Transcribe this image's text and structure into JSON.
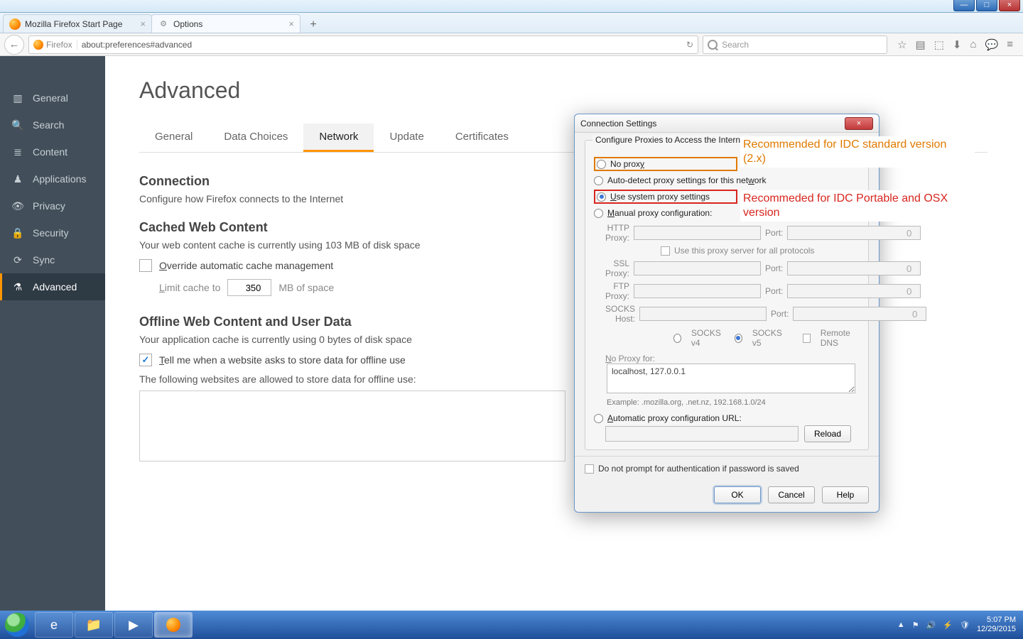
{
  "window": {
    "min": "—",
    "max": "□",
    "close": "×"
  },
  "tabs": {
    "tab1": "Mozilla Firefox Start Page",
    "tab2": "Options",
    "newtab": "+"
  },
  "nav": {
    "back": "←",
    "identity_label": "Firefox",
    "url": "about:preferences#advanced",
    "reload": "↻",
    "search_placeholder": "Search"
  },
  "toolbar_icons": {
    "bookmark": "☆",
    "clipboard": "▤",
    "pocket": "⬚",
    "download": "⬇",
    "home": "⌂",
    "chat": "💬",
    "menu": "≡"
  },
  "sidebar": {
    "items": [
      {
        "icon": "▥",
        "label": "General"
      },
      {
        "icon": "🔍",
        "label": "Search"
      },
      {
        "icon": "≣",
        "label": "Content"
      },
      {
        "icon": "♟",
        "label": "Applications"
      },
      {
        "icon": "👁",
        "label": "Privacy"
      },
      {
        "icon": "🔒",
        "label": "Security"
      },
      {
        "icon": "⟳",
        "label": "Sync"
      },
      {
        "icon": "⚗",
        "label": "Advanced"
      }
    ]
  },
  "page": {
    "title": "Advanced",
    "subtabs": [
      "General",
      "Data Choices",
      "Network",
      "Update",
      "Certificates"
    ],
    "connection_h": "Connection",
    "connection_desc": "Configure how Firefox connects to the Internet",
    "cached_h": "Cached Web Content",
    "cached_desc": "Your web content cache is currently using 103 MB of disk space",
    "override_label_pre": "O",
    "override_label": "verride automatic cache management",
    "limit_pre": "L",
    "limit_label": "imit cache to",
    "limit_val": "350",
    "limit_unit": "MB of space",
    "offline_h": "Offline Web Content and User Data",
    "offline_desc": "Your application cache is currently using 0 bytes of disk space",
    "tell_pre": "T",
    "tell_label": "ell me when a website asks to store data for offline use",
    "allowed": "The following websites are allowed to store data for offline use:"
  },
  "dialog": {
    "title": "Connection Settings",
    "legend": "Configure Proxies to Access the Internet",
    "no_proxy": "No prox",
    "no_proxy_u": "y",
    "auto_detect": "Auto-detect proxy settings for this net",
    "auto_detect_u": "w",
    "auto_detect_post": "ork",
    "use_system_u": "U",
    "use_system": "se system proxy settings",
    "manual_u": "M",
    "manual": "anual proxy configuration:",
    "http": "HTTP Proxy:",
    "ssl": "SSL Proxy:",
    "ftp": "FTP Proxy:",
    "socks": "SOCKS Host:",
    "port": "Port:",
    "port_val": "0",
    "use_all": "Use this proxy server for all protocols",
    "socks4": "SOCKS v4",
    "socks5": "SOCKS v5",
    "remote": "Remote DNS",
    "noproxy_label_u": "N",
    "noproxy_label": "o Proxy for:",
    "noproxy_val": "localhost, 127.0.0.1",
    "example": "Example: .mozilla.org, .net.nz, 192.168.1.0/24",
    "pac_u": "A",
    "pac": "utomatic proxy configuration URL:",
    "reload": "Reload",
    "noprompt": "Do not prompt for authentication if password is saved",
    "ok": "OK",
    "cancel": "Cancel",
    "help": "Help"
  },
  "annotations": {
    "orange": "Recommended for IDC standard version (2.x)",
    "red": "Recommeded for IDC Portable and OSX version"
  },
  "taskbar": {
    "time": "5:07 PM",
    "date": "12/29/2015"
  }
}
